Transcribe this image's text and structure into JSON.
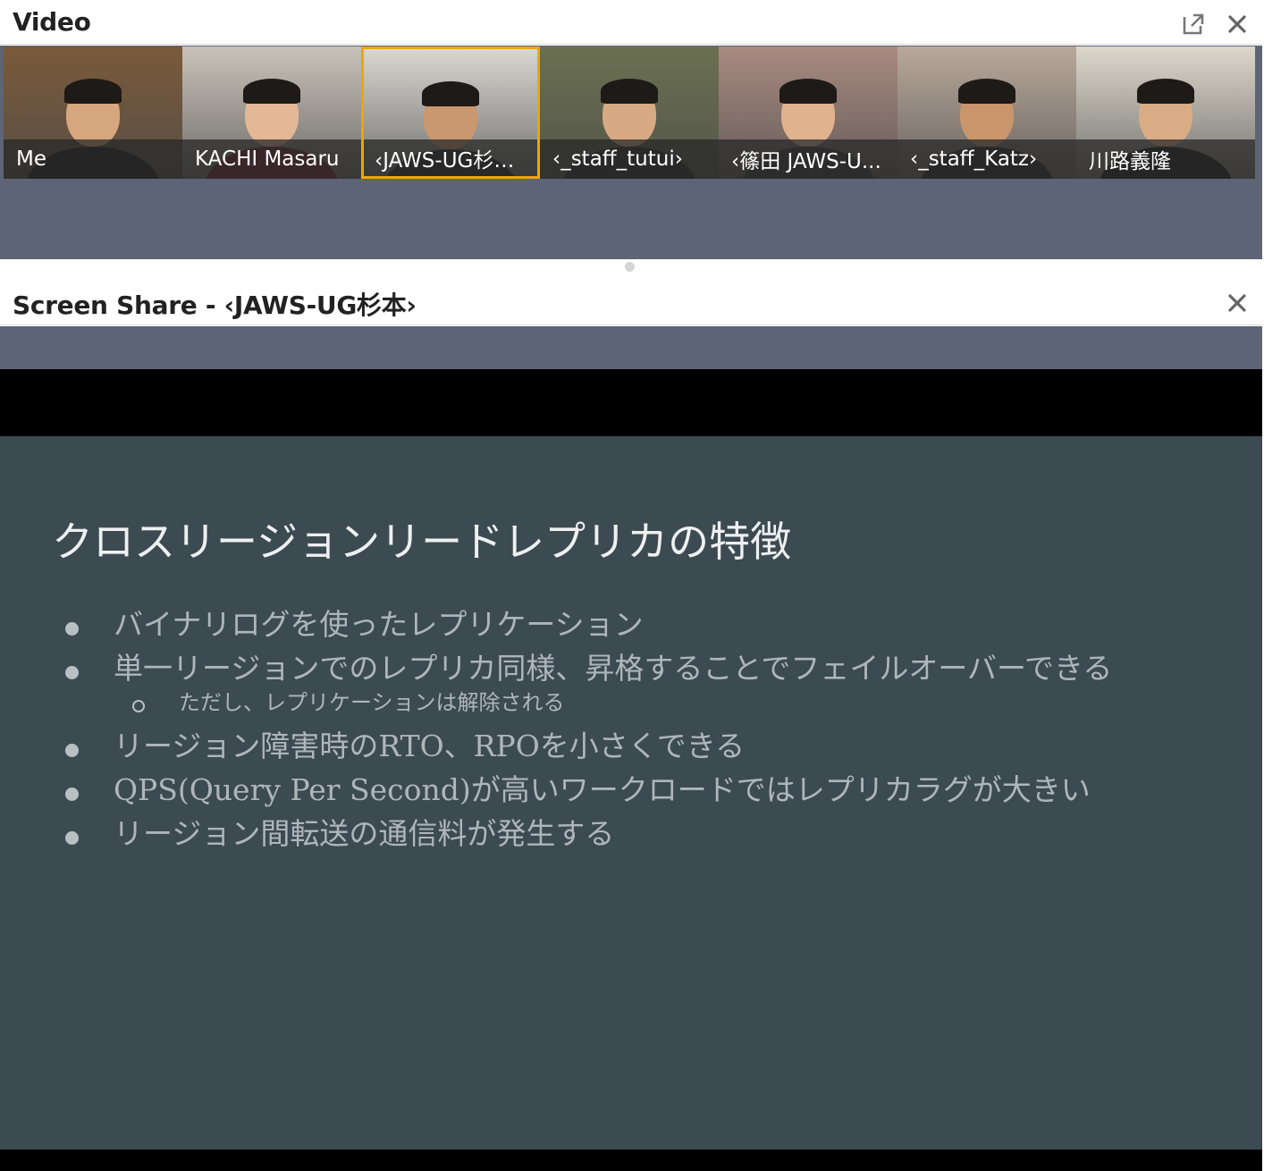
{
  "video_panel": {
    "title": "Video",
    "popout_icon": "popout-icon",
    "close_icon": "close-icon",
    "participants": [
      {
        "name": "Me",
        "active": false,
        "bg": "#7a5a3a"
      },
      {
        "name": "KACHI Masaru",
        "active": false,
        "bg": "#c9c2b8"
      },
      {
        "name": "‹JAWS-UG杉…",
        "active": true,
        "bg": "#d8d6d0"
      },
      {
        "name": "‹_staff_tutui›",
        "active": false,
        "bg": "#6b7050"
      },
      {
        "name": "‹篠田 JAWS-U...",
        "active": false,
        "bg": "#a88a80"
      },
      {
        "name": "‹_staff_Katz›",
        "active": false,
        "bg": "#b8a89a"
      },
      {
        "name": "川路義隆",
        "active": false,
        "bg": "#ddd8cc"
      }
    ]
  },
  "share_panel": {
    "title": "Screen Share - ‹JAWS-UG杉本›",
    "close_icon": "close-icon"
  },
  "slide": {
    "title": "クロスリージョンリードレプリカの特徴",
    "bullets": [
      "バイナリログを使ったレプリケーション",
      "単一リージョンでのレプリカ同様、昇格することでフェイルオーバーできる",
      "リージョン障害時のRTO、RPOを小さくできる",
      "QPS(Query Per Second)が高いワークロードではレプリカラグが大きい",
      "リージョン間転送の通信料が発生する"
    ],
    "sub_bullet": "ただし、レプリケーションは解除される"
  }
}
